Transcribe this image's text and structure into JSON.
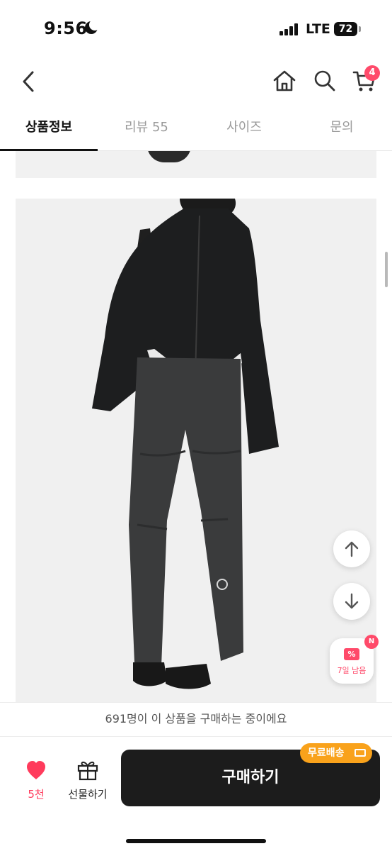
{
  "status_bar": {
    "time": "9:56",
    "network": "LTE",
    "battery": "72"
  },
  "nav": {
    "back_icon": "chevron-left-icon",
    "home_icon": "home-icon",
    "search_icon": "search-icon",
    "cart_icon": "cart-icon",
    "cart_count": "4"
  },
  "tabs": [
    {
      "label": "상품정보",
      "active": true
    },
    {
      "label": "리뷰 55",
      "active": false
    },
    {
      "label": "사이즈",
      "active": false
    },
    {
      "label": "문의",
      "active": false
    }
  ],
  "floating": {
    "scroll_up_icon": "arrow-up-icon",
    "scroll_down_icon": "arrow-down-icon",
    "coupon_badge": "N",
    "coupon_icon_text": "%",
    "coupon_text": "7일 남음"
  },
  "notice": {
    "text": "691명이 이 상품을 구매하는 중이에요"
  },
  "bottom_bar": {
    "like_count": "5천",
    "gift_label": "선물하기",
    "buy_label": "구매하기",
    "shipping_tag": "무료배송"
  },
  "colors": {
    "accent": "#ff4a6a",
    "shipping": "#f9a21b",
    "buy_button": "#1c1c1c"
  }
}
